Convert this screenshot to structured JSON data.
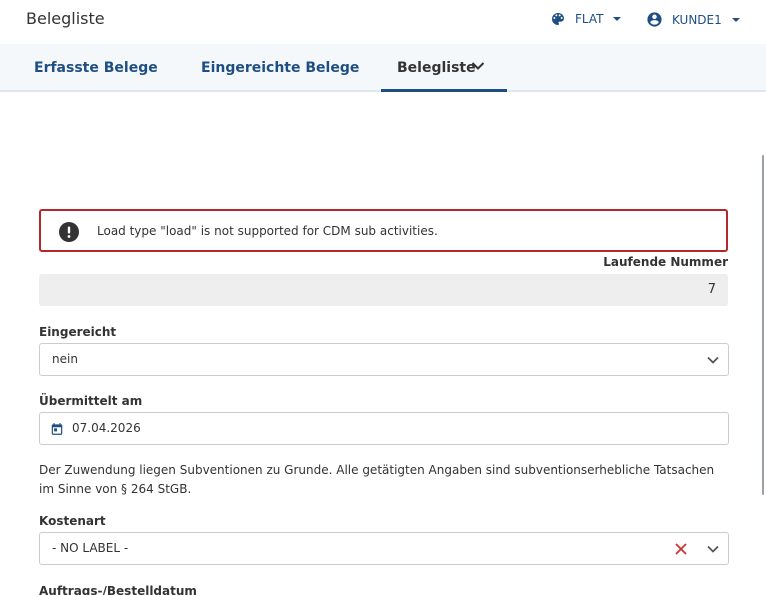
{
  "header": {
    "title": "Belegliste",
    "theme_label": "FLAT",
    "user_label": "KUNDE1"
  },
  "tabs": [
    {
      "label": "Erfasste Belege",
      "active": false
    },
    {
      "label": "Eingereichte Belege",
      "active": false
    },
    {
      "label": "Belegliste",
      "active": true
    }
  ],
  "alert": {
    "message": "Load type \"load\" is not supported for CDM sub activities.",
    "color": "#b3282d"
  },
  "form": {
    "laufende_nummer": {
      "label": "Laufende Nummer",
      "value": "7"
    },
    "eingereicht": {
      "label": "Eingereicht",
      "value": "nein"
    },
    "uebermittelt": {
      "label": "Übermittelt am",
      "value": "07.04.2026"
    },
    "notice": "Der Zuwendung liegen Subventionen zu Grunde. Alle getätigten Angaben sind subventionserhebliche Tatsachen im Sinne von § 264 StGB.",
    "kostenart": {
      "label": "Kostenart",
      "value": "- NO LABEL -"
    },
    "auftragsdatum": {
      "label": "Auftrags-/Bestelldatum"
    }
  },
  "colors": {
    "primary": "#1f4f82",
    "error": "#b3282d",
    "clear": "#d32f2f"
  }
}
